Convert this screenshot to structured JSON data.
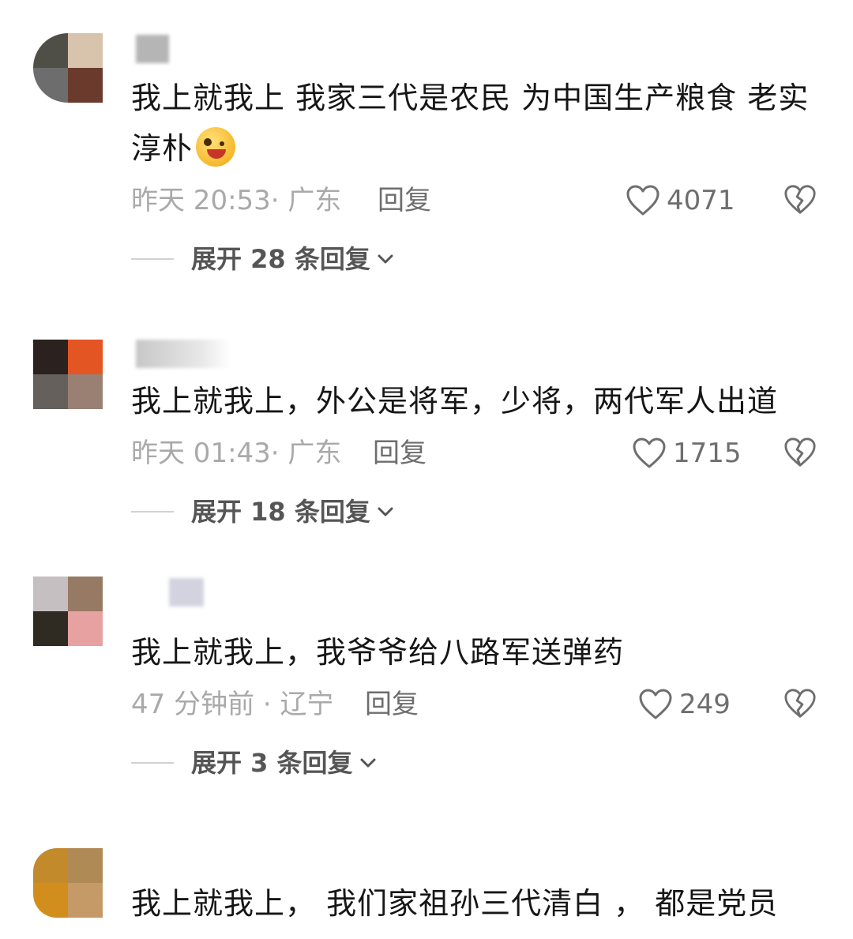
{
  "colors": {
    "text_primary": "#161616",
    "text_muted": "#a9a9a9",
    "text_secondary": "#6e6e6e",
    "expand_text": "#555555"
  },
  "icons": {
    "like": "heart-outline-icon",
    "dislike": "broken-heart-icon",
    "expand": "chevron-down-icon",
    "emoji": "winking-tongue-emoji-icon"
  },
  "comments": [
    {
      "text": "我上就我上 我家三代是农民 为中国生产粮食 老实淳朴",
      "time_location": "昨天 20:53· 广东",
      "reply_label": "回复",
      "likes": "4071",
      "expand_label": "展开 28 条回复"
    },
    {
      "text": "我上就我上，外公是将军，少将，两代军人出道",
      "time_location": "昨天 01:43· 广东",
      "reply_label": "回复",
      "likes": "1715",
      "expand_label": "展开 18 条回复"
    },
    {
      "text": "我上就我上，我爷爷给八路军送弹药",
      "time_location": "47 分钟前 · 辽宁",
      "reply_label": "回复",
      "likes": "249",
      "expand_label": "展开 3 条回复"
    },
    {
      "text": "我上就我上， 我们家祖孙三代清白 ， 都是党员"
    }
  ]
}
